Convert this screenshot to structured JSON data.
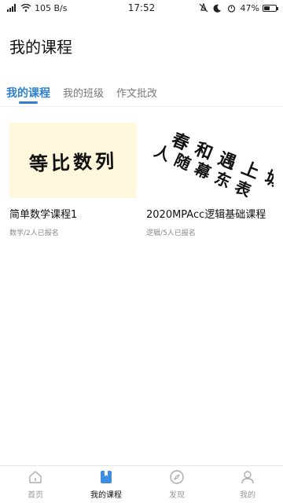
{
  "status": {
    "speed": "105 B/s",
    "time": "17:52",
    "battery": "47%",
    "battery_level": 0.47
  },
  "page": {
    "title": "我的课程"
  },
  "tabs": [
    {
      "label": "我的课程",
      "active": true
    },
    {
      "label": "我的班级",
      "active": false
    },
    {
      "label": "作文批改",
      "active": false
    }
  ],
  "courses": [
    {
      "thumbnail_text": "等比数列",
      "title": "简单数学课程1",
      "meta": "数学/2人已报名"
    },
    {
      "thumbnail_text_lines": [
        "春和遇上城",
        "人随幕东表"
      ],
      "title": "2020MPAcc逻辑基础课程",
      "meta": "逻辑/5人已报名"
    }
  ],
  "bottom_nav": [
    {
      "label": "首页",
      "icon": "home-icon",
      "active": false
    },
    {
      "label": "我的课程",
      "icon": "bookmark-icon",
      "active": true
    },
    {
      "label": "发现",
      "icon": "compass-icon",
      "active": false
    },
    {
      "label": "我的",
      "icon": "user-icon",
      "active": false
    }
  ],
  "colors": {
    "accent": "#2f7fcf",
    "nav_active_icon": "#3d8fe0",
    "thumbnail_bg": "#fff8dd"
  }
}
